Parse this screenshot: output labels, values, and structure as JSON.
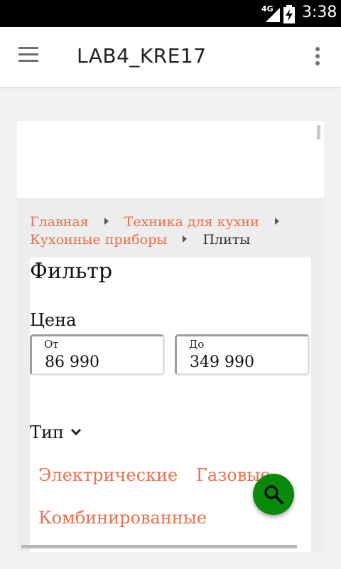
{
  "status_bar": {
    "network": "4G",
    "time": "3:38"
  },
  "app_bar": {
    "title": "LAB4_KRE17"
  },
  "breadcrumb": {
    "items": [
      "Главная",
      "Техника для кухни",
      "Кухонные приборы"
    ],
    "current": "Плиты"
  },
  "filter": {
    "title": "Фильтр",
    "price_label": "Цена",
    "price_from_caption": "От",
    "price_from_value": "86 990",
    "price_to_caption": "До",
    "price_to_value": "349 990",
    "type_label": "Тип",
    "type_options": [
      "Электрические",
      "Газовые",
      "Комбинированные"
    ]
  },
  "colors": {
    "link": "#e8704e",
    "fab": "#0a8a0a"
  },
  "icons": {
    "menu": "hamburger-menu-icon",
    "more": "more-vert-icon",
    "fab": "search-icon",
    "type_toggle": "chevron-down-icon"
  }
}
